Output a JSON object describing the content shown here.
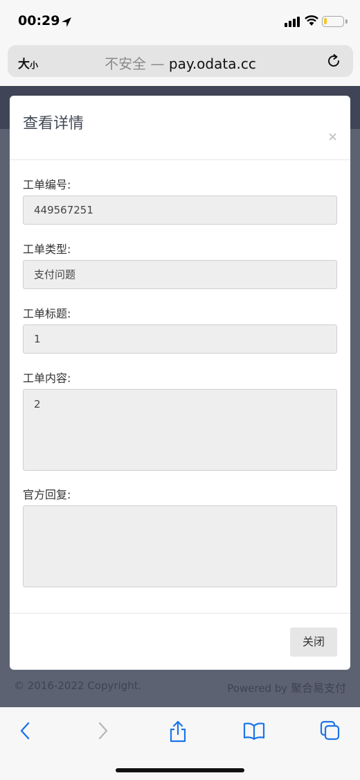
{
  "status_bar": {
    "time": "00:29"
  },
  "browser": {
    "text_size_large": "大",
    "text_size_small": "小",
    "url_prefix": "不安全 —",
    "url_domain": "pay.odata.cc"
  },
  "footer": {
    "copyright": "© 2016-2022 Copyright.",
    "powered_by": "Powered by",
    "brand": "聚合易支付"
  },
  "modal": {
    "title": "查看详情",
    "close_symbol": "×",
    "fields": [
      {
        "label": "工单编号:",
        "value": "449567251"
      },
      {
        "label": "工单类型:",
        "value": "支付问题"
      },
      {
        "label": "工单标题:",
        "value": "1"
      },
      {
        "label": "工单内容:",
        "value": "2"
      },
      {
        "label": "官方回复:",
        "value": ""
      }
    ],
    "close_button": "关闭"
  },
  "icons": {
    "location": "location-arrow-icon",
    "signal": "cellular-signal-icon",
    "wifi": "wifi-icon",
    "battery": "battery-icon",
    "reload": "reload-icon",
    "back": "back-icon",
    "forward": "forward-icon",
    "share": "share-icon",
    "bookmarks": "bookmarks-icon",
    "tabs": "tabs-icon"
  },
  "colors": {
    "accent": "#1a74e8",
    "battery_level": "#f3c623",
    "backdrop": "#5d6272"
  }
}
